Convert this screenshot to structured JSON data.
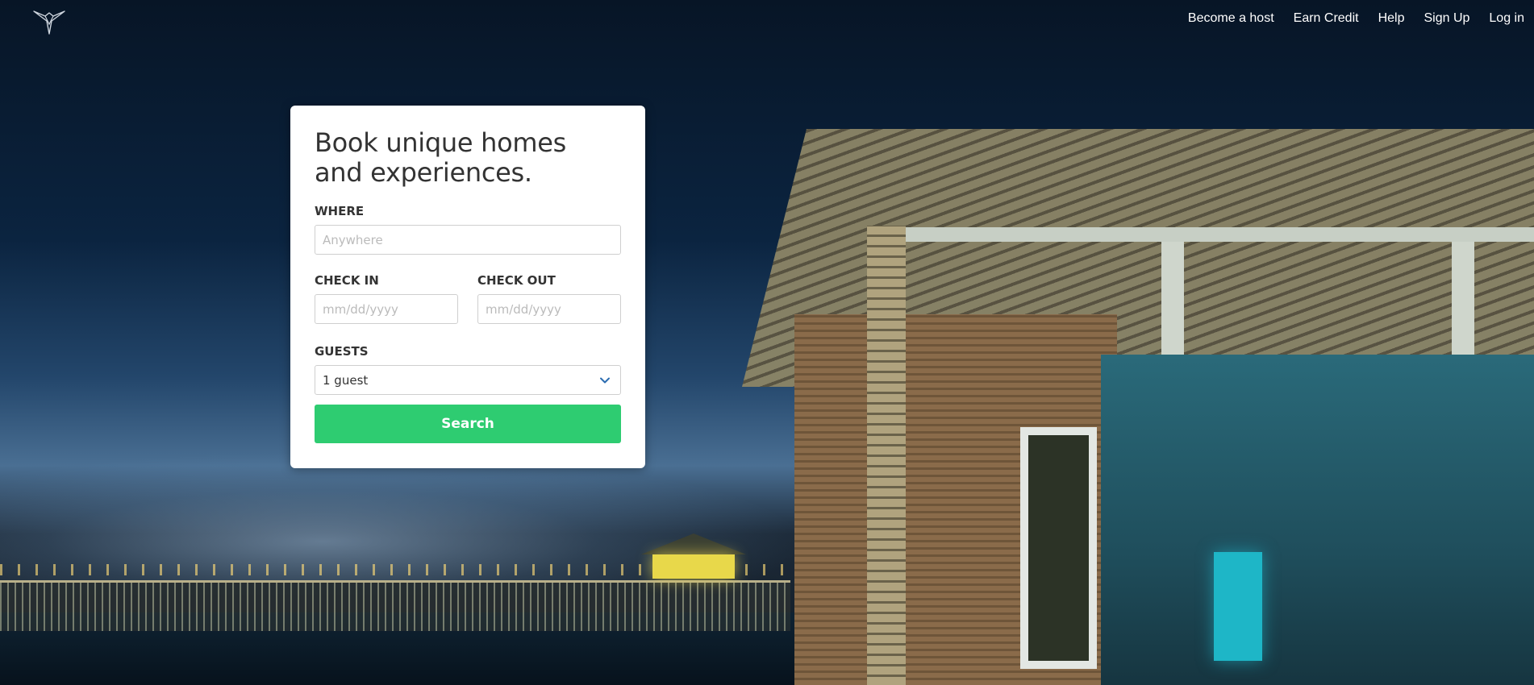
{
  "nav": {
    "logo_icon": "bird-logo-icon",
    "links": [
      "Become a host",
      "Earn Credit",
      "Help",
      "Sign Up",
      "Log in"
    ]
  },
  "search_card": {
    "title": "Book unique homes and experiences.",
    "where_label": "WHERE",
    "where_placeholder": "Anywhere",
    "check_in_label": "CHECK IN",
    "check_in_placeholder": "mm/dd/yyyy",
    "check_out_label": "CHECK OUT",
    "check_out_placeholder": "mm/dd/yyyy",
    "guests_label": "GUESTS",
    "guests_value": "1 guest",
    "search_button": "Search"
  },
  "colors": {
    "accent": "#2ecc71",
    "card_bg": "#ffffff",
    "chevron": "#2b6cb0"
  }
}
